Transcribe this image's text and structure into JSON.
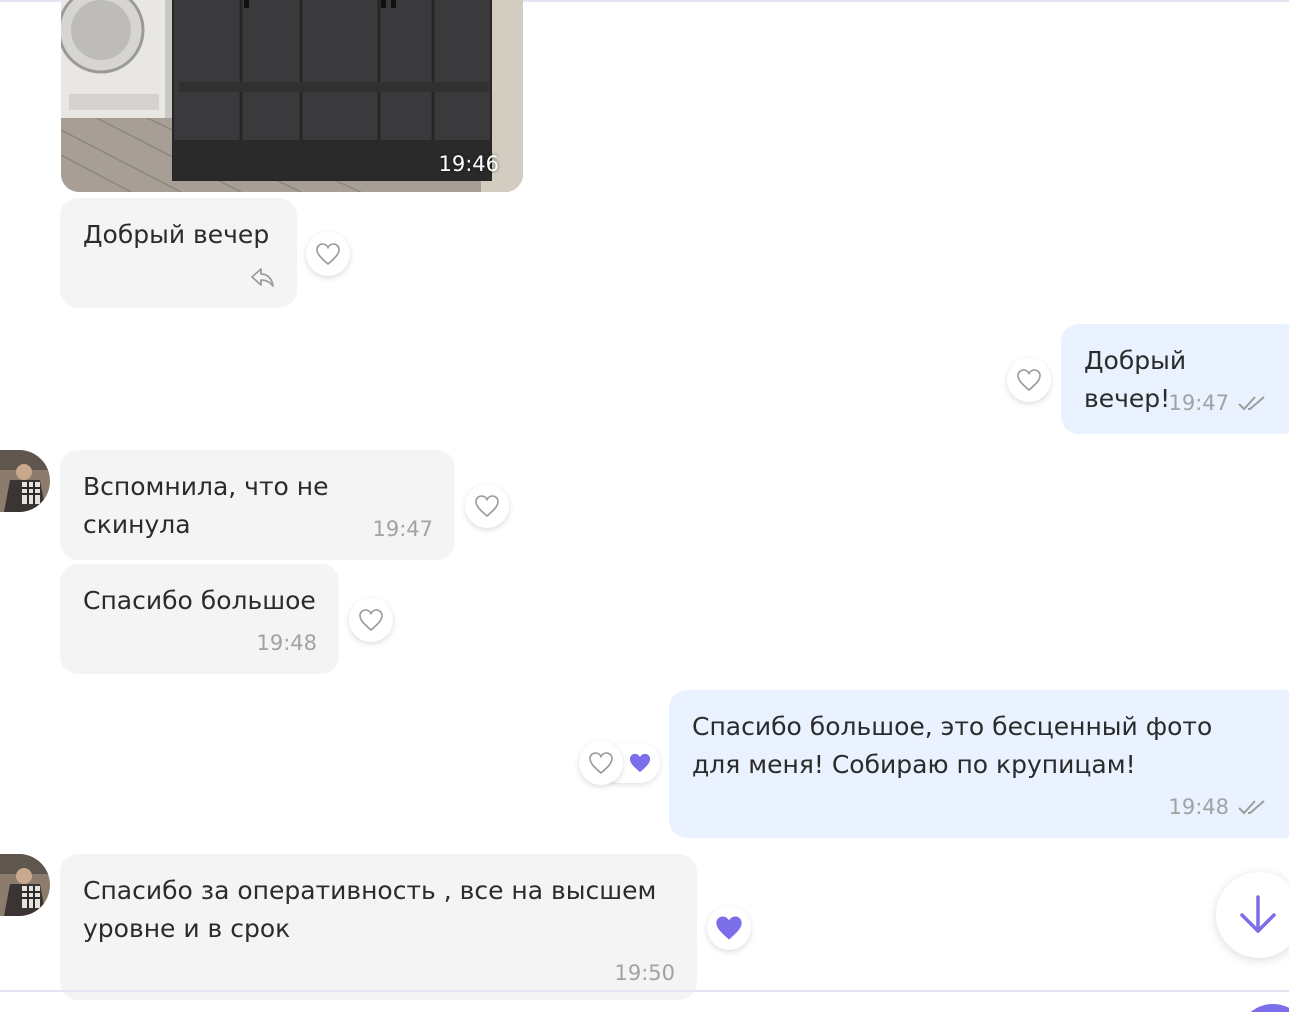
{
  "messages": [
    {
      "side": "in",
      "kind": "photo",
      "time": "19:46"
    },
    {
      "side": "in",
      "text": "Добрый вечер",
      "status_icon": "reply-icon"
    },
    {
      "side": "out",
      "text": "Добрый вечер!",
      "time": "19:47",
      "status_icon": "double-check-icon"
    },
    {
      "side": "in",
      "text": "Вспомнила, что не скинула",
      "time": "19:47"
    },
    {
      "side": "in",
      "text": "Спасибо большое",
      "time": "19:48"
    },
    {
      "side": "out",
      "text": "Спасибо большое, это бесценный фото для меня! Собираю по крупицам!",
      "time": "19:48",
      "status_icon": "double-check-icon",
      "reaction": "heart"
    },
    {
      "side": "in",
      "text": "Спасибо за оперативность , все на высшем уровне и в срок",
      "time": "19:50",
      "reaction": "heart"
    }
  ],
  "colors": {
    "incoming_bubble": "#f4f4f4",
    "outgoing_bubble": "#e9f2fe",
    "accent": "#7b6ee8",
    "time_text": "#a2a2a2"
  },
  "icons": {
    "reaction_button": "heart-outline-icon",
    "reaction_filled": "heart-filled-icon",
    "scroll_down": "arrow-down-icon"
  }
}
